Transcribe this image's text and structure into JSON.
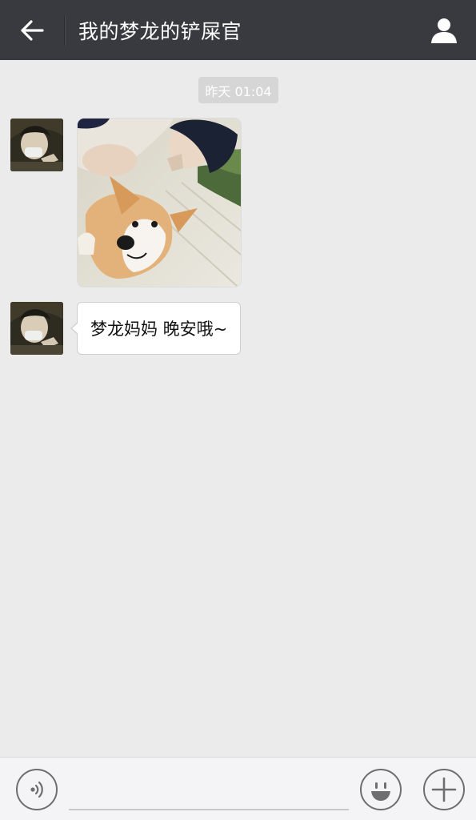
{
  "header": {
    "title": "我的梦龙的铲屎官",
    "back_icon": "arrow-left-icon",
    "profile_icon": "person-icon"
  },
  "chat": {
    "timestamp": "昨天 01:04",
    "messages": [
      {
        "type": "image",
        "sender": "contact",
        "content": "photo of a person with a corgi dog"
      },
      {
        "type": "text",
        "sender": "contact",
        "text": "梦龙妈妈 晚安哦~"
      }
    ]
  },
  "input_bar": {
    "voice_icon": "voice-icon",
    "input_value": "",
    "emoji_icon": "smiley-icon",
    "plus_icon": "plus-icon"
  },
  "colors": {
    "header_bg": "#393a3f",
    "chat_bg": "#ebebeb",
    "bubble_bg": "#ffffff",
    "timestamp_bg": "#d6d6d6"
  }
}
